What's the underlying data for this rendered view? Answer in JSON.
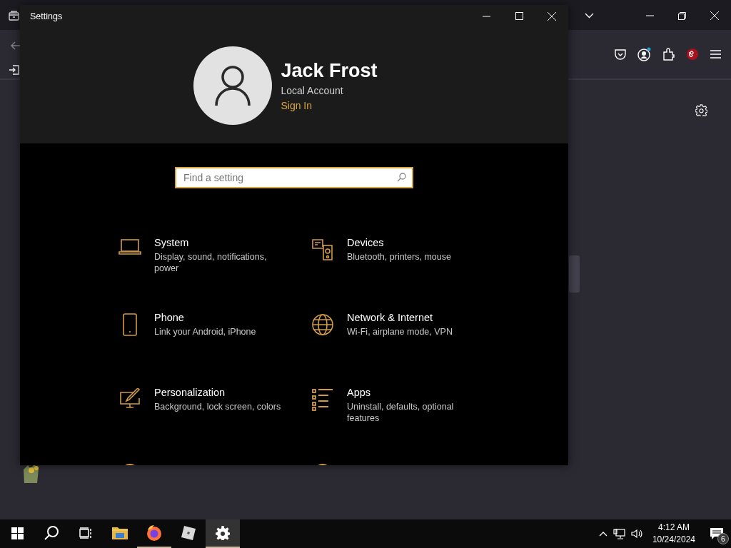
{
  "settings_window": {
    "title": "Settings"
  },
  "account": {
    "name": "Jack Frost",
    "type": "Local Account",
    "link": "Sign In"
  },
  "search": {
    "placeholder": "Find a setting",
    "focused": true
  },
  "categories": [
    {
      "title": "System",
      "description": "Display, sound, notifications, power"
    },
    {
      "title": "Devices",
      "description": "Bluetooth, printers, mouse"
    },
    {
      "title": "Phone",
      "description": "Link your Android, iPhone"
    },
    {
      "title": "Network & Internet",
      "description": "Wi-Fi, airplane mode, VPN"
    },
    {
      "title": "Personalization",
      "description": "Background, lock screen, colors"
    },
    {
      "title": "Apps",
      "description": "Uninstall, defaults, optional features"
    }
  ],
  "taskbar": {
    "apps": [
      {
        "running": false,
        "active": false
      },
      {
        "running": true,
        "active": false
      },
      {
        "running": false,
        "active": false
      },
      {
        "running": true,
        "active": true
      }
    ],
    "time": "4:12 AM",
    "date": "10/24/2024",
    "notification_count": "6"
  }
}
